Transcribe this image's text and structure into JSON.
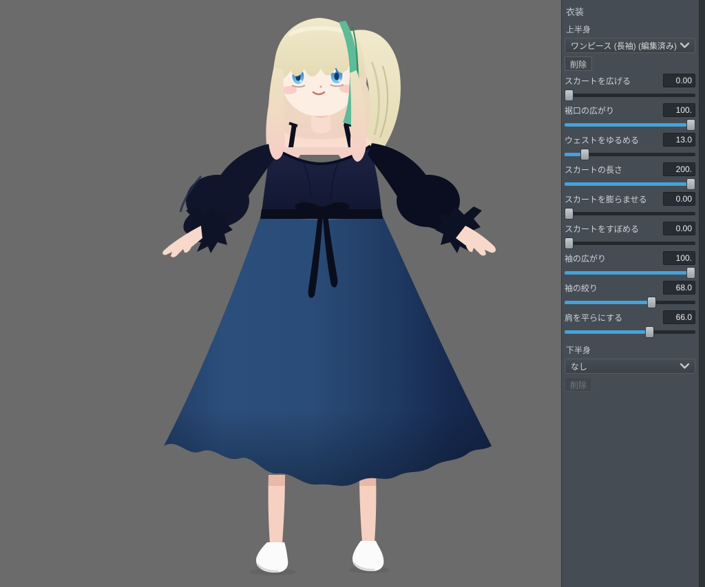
{
  "panel": {
    "title": "衣装",
    "upper_body": {
      "label": "上半身",
      "dropdown_value": "ワンピース (長袖) (編集済み)",
      "delete_label": "削除"
    },
    "sliders": [
      {
        "label": "スカートを広げる",
        "value": "0.00",
        "percent": 0
      },
      {
        "label": "裾口の広がり",
        "value": "100.",
        "percent": 100
      },
      {
        "label": "ウェストをゆるめる",
        "value": "13.0",
        "percent": 13
      },
      {
        "label": "スカートの長さ",
        "value": "200.",
        "percent": 100
      },
      {
        "label": "スカートを膨らませる",
        "value": "0.00",
        "percent": 0
      },
      {
        "label": "スカートをすぼめる",
        "value": "0.00",
        "percent": 0
      },
      {
        "label": "袖の広がり",
        "value": "100.",
        "percent": 100
      },
      {
        "label": "袖の絞り",
        "value": "68.0",
        "percent": 68
      },
      {
        "label": "肩を平らにする",
        "value": "66.0",
        "percent": 66
      }
    ],
    "lower_body": {
      "label": "下半身",
      "dropdown_value": "なし",
      "delete_label": "削除"
    },
    "colors": {
      "accent_blue": "#45a3da",
      "panel_bg": "#454c54",
      "canvas_bg": "#6b6b6b"
    }
  }
}
